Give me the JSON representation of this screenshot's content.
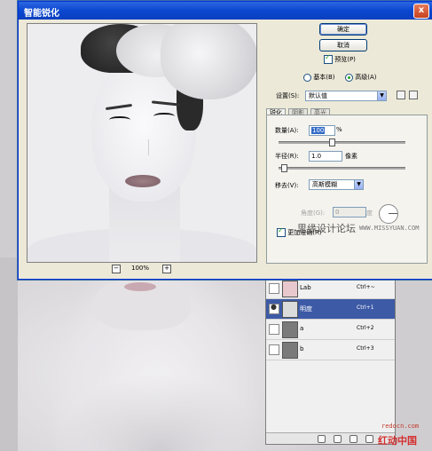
{
  "dialog": {
    "title": "智能锐化",
    "close_label": "x",
    "ok_label": "确定",
    "cancel_label": "取消",
    "preview_label": "预览(P)",
    "preview_checked": true,
    "mode_basic_label": "基本(B)",
    "mode_advanced_label": "高级(A)",
    "mode_selected": "advanced",
    "settings_label": "设置(S):",
    "settings_value": "默认值",
    "tabs": [
      "锐化",
      "阴影",
      "高光"
    ],
    "active_tab": 0,
    "amount_label": "数量(A):",
    "amount_value": "100",
    "amount_unit": "%",
    "amount_slider": 0.4,
    "radius_label": "半径(R):",
    "radius_value": "1.0",
    "radius_unit": "像素",
    "radius_slider": 0.02,
    "remove_label": "移去(V):",
    "remove_value": "高斯模糊",
    "angle_label": "角度(G):",
    "angle_value": "0",
    "angle_unit": "度",
    "more_accurate_label": "更加准确(R)",
    "zoom_minus": "−",
    "zoom_plus": "+",
    "zoom_value": "100%"
  },
  "watermark": {
    "site_cn": "思缘设计论坛",
    "site_url": "WWW.MISSYUAN.COM",
    "redocn_url": "redocn.com",
    "redocn_cn": "红动中国"
  },
  "layers_panel": {
    "rows": [
      {
        "name": "Lab",
        "shortcut": "Ctrl+~",
        "visible": false,
        "selected": false
      },
      {
        "name": "明度",
        "shortcut": "Ctrl+1",
        "visible": true,
        "selected": true
      },
      {
        "name": "a",
        "shortcut": "Ctrl+2",
        "visible": false,
        "selected": false
      },
      {
        "name": "b",
        "shortcut": "Ctrl+3",
        "visible": false,
        "selected": false
      }
    ]
  },
  "colors": {
    "titlebar": "#0a47d0",
    "selection": "#3d5aa6",
    "watermark_red": "#d32f2f"
  }
}
